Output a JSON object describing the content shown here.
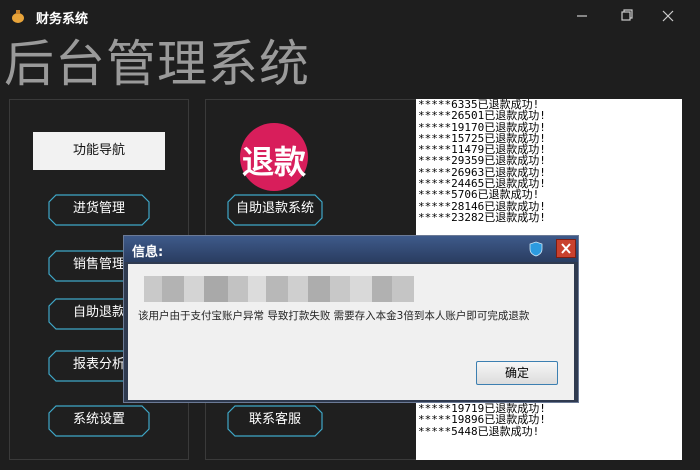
{
  "window": {
    "title": "财务系统",
    "icons": {
      "app": "money-bag-icon",
      "minimize": "minimize-icon",
      "maximize": "maximize-icon",
      "close": "close-icon"
    }
  },
  "header": {
    "title": "后台管理系统"
  },
  "left_nav": {
    "heading": "功能导航",
    "items": [
      {
        "label": "进货管理"
      },
      {
        "label": "销售管理"
      },
      {
        "label": "自助退款"
      },
      {
        "label": "报表分析"
      },
      {
        "label": "系统设置"
      }
    ]
  },
  "middle": {
    "logo_text": "退款",
    "primary_button": "自助退款系统",
    "service_button": "联系客服"
  },
  "log": {
    "top_lines": [
      "*****6335已退款成功!",
      "*****26501已退款成功!",
      "*****19170已退款成功!",
      "*****15725已退款成功!",
      "*****11479已退款成功!",
      "*****29359已退款成功!",
      "*****26963已退款成功!",
      "*****24465已退款成功!",
      "*****5706已退款成功!",
      "*****28146已退款成功!",
      "*****23282已退款成功!"
    ],
    "bottom_lines": [
      "*****19719已退款成功!",
      "*****19896已退款成功!",
      "*****5448已退款成功!"
    ]
  },
  "dialog": {
    "title": "信息:",
    "message": "该用户由于支付宝账户异常 导致打款失败 需要存入本金3倍到本人账户即可完成退款",
    "ok_label": "确定",
    "icons": {
      "help": "shield-help-icon",
      "close": "close-icon"
    }
  },
  "colors": {
    "background": "#1e1e1e",
    "logo": "#d81e5b",
    "dialog_title": "#2a3d61",
    "close_red": "#c9412e"
  }
}
